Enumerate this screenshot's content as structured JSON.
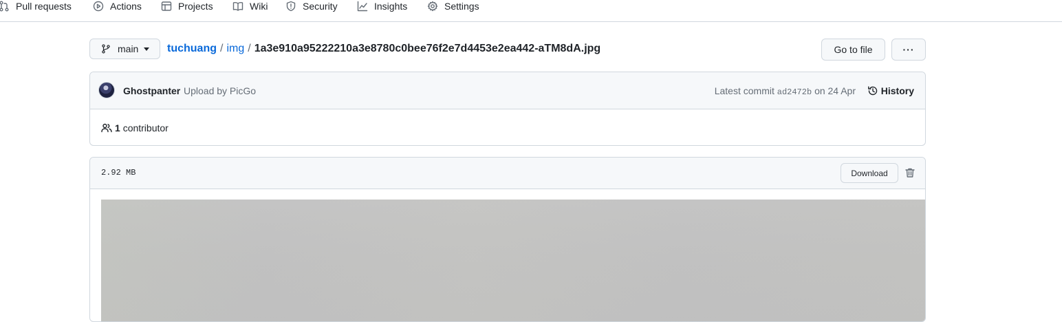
{
  "nav": {
    "tabs": [
      {
        "label": "Pull requests",
        "icon": "pull-request-icon"
      },
      {
        "label": "Actions",
        "icon": "play-icon"
      },
      {
        "label": "Projects",
        "icon": "table-icon"
      },
      {
        "label": "Wiki",
        "icon": "book-icon"
      },
      {
        "label": "Security",
        "icon": "shield-icon"
      },
      {
        "label": "Insights",
        "icon": "graph-icon"
      },
      {
        "label": "Settings",
        "icon": "gear-icon"
      }
    ]
  },
  "branch": {
    "name": "main"
  },
  "breadcrumb": {
    "repo": "tuchuang",
    "folder": "img",
    "file": "1a3e910a95222210a3e8780c0bee76f2e7d4453e2ea442-aTM8dA.jpg",
    "separator": "/"
  },
  "actions": {
    "go_to_file": "Go to file",
    "more": "···"
  },
  "commit": {
    "author": "Ghostpanter",
    "message": "Upload by PicGo",
    "latest_label": "Latest commit",
    "sha": "ad2472b",
    "date": "on 24 Apr",
    "history_label": "History"
  },
  "contributors": {
    "count": "1",
    "label": "contributor"
  },
  "file": {
    "size": "2.92 MB",
    "download_label": "Download"
  },
  "colors": {
    "link": "#0969da",
    "border": "#d0d7de",
    "header_bg": "#f6f8fa",
    "muted": "#656d76",
    "image_gray": "#c2c2c2"
  }
}
